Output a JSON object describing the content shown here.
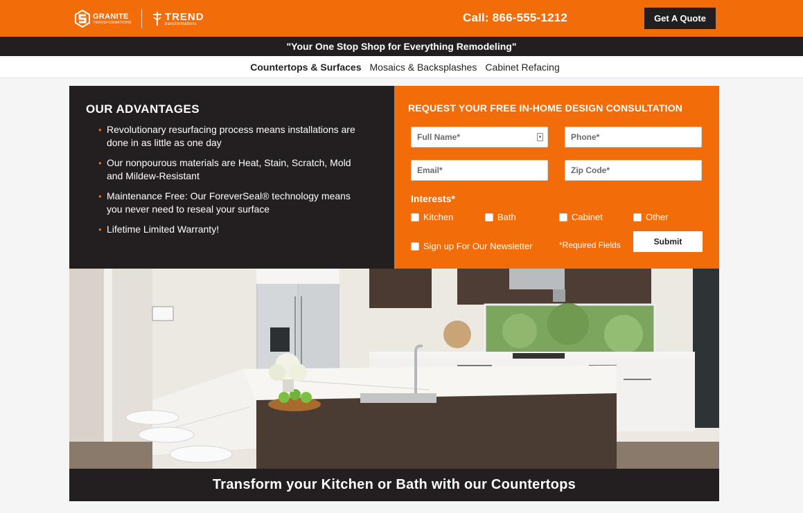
{
  "header": {
    "logo_granite": "GRANITE",
    "logo_granite_sub": "TRANSFORMATIONS",
    "logo_trend": "TREND",
    "logo_trend_sub": "transformations",
    "phone": "Call: 866-555-1212",
    "quote_button": "Get A Quote",
    "brand_color": "#f36c0a",
    "dark_color": "#231f20"
  },
  "tagline": "\"Your One Stop Shop for Everything Remodeling\"",
  "nav": {
    "items": [
      {
        "label": "Countertops & Surfaces",
        "active": true
      },
      {
        "label": "Mosaics & Backsplashes",
        "active": false
      },
      {
        "label": "Cabinet Refacing",
        "active": false
      }
    ]
  },
  "advantages": {
    "title": "OUR ADVANTAGES",
    "items": [
      "Revolutionary resurfacing process means installations are done in as little as one day",
      "Our nonpourous materials are Heat, Stain, Scratch, Mold and Mildew-Resistant",
      "Maintenance Free: Our ForeverSeal® technology means you never need to reseal your surface",
      "Lifetime Limited Warranty!"
    ]
  },
  "form": {
    "title": "REQUEST YOUR FREE IN-HOME DESIGN CONSULTATION",
    "full_name_placeholder": "Full Name*",
    "phone_placeholder": "Phone*",
    "email_placeholder": "Email*",
    "zip_placeholder": "Zip Code*",
    "interests_label": "Interests*",
    "interests": [
      "Kitchen",
      "Bath",
      "Cabinet",
      "Other"
    ],
    "newsletter_label": "Sign up For Our Newsletter",
    "required_note": "*Required Fields",
    "submit_label": "Submit"
  },
  "hero": {
    "image": "kitchen-photo",
    "caption": "Transform your Kitchen or Bath with our Countertops"
  }
}
